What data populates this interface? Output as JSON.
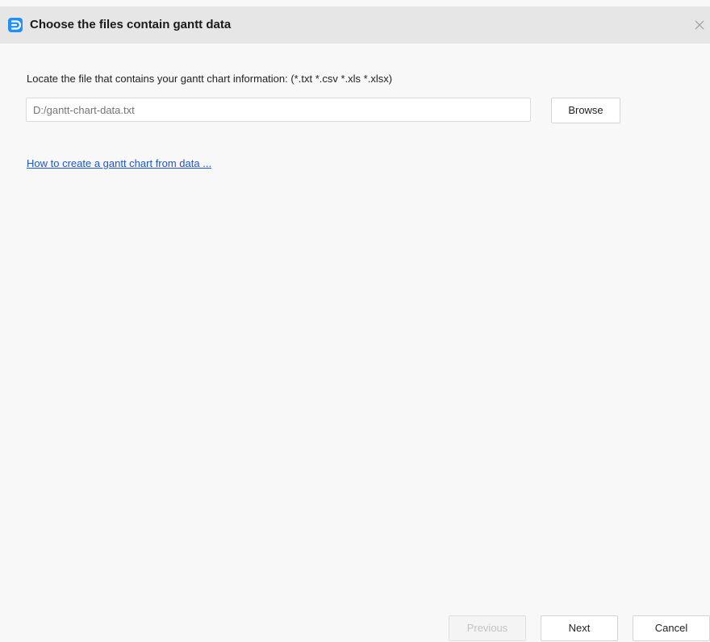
{
  "window": {
    "title": "Choose the files contain gantt data",
    "app_icon": "app-logo-icon",
    "close_icon": "close-icon"
  },
  "main": {
    "locate_label": "Locate the file that contains your gantt chart information: (*.txt *.csv *.xls *.xlsx)",
    "file_path": {
      "value": "",
      "placeholder": "D:/gantt-chart-data.txt"
    },
    "browse_label": "Browse",
    "help_link": "How to create a gantt chart from data ..."
  },
  "footer": {
    "previous_label": "Previous",
    "previous_enabled": false,
    "next_label": "Next",
    "cancel_label": "Cancel"
  },
  "colors": {
    "app_icon": "#1e90ff",
    "link": "#1a56d8",
    "titlebar": "#e6e6e6",
    "body": "#f8f8f8"
  }
}
